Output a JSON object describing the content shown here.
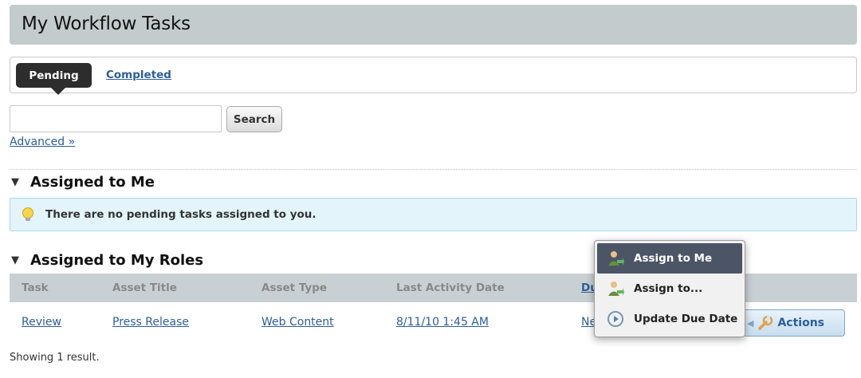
{
  "page_title": "My Workflow Tasks",
  "tabs": {
    "pending": "Pending",
    "completed": "Completed"
  },
  "search": {
    "value": "",
    "button": "Search",
    "advanced": "Advanced »"
  },
  "assigned_to_me": {
    "heading": "Assigned to Me",
    "message": "There are no pending tasks assigned to you."
  },
  "assigned_to_roles": {
    "heading": "Assigned to My Roles",
    "columns": [
      "Task",
      "Asset Title",
      "Asset Type",
      "Last Activity Date",
      "Du"
    ],
    "rows": [
      {
        "task": "Review",
        "asset_title": "Press Release",
        "asset_type": "Web Content",
        "last_activity": "8/11/10 1:45 AM",
        "due": "Ne"
      }
    ]
  },
  "actions": {
    "label": "Actions"
  },
  "menu": {
    "items": [
      {
        "label": "Assign to Me",
        "icon": "assign-user-icon"
      },
      {
        "label": "Assign to...",
        "icon": "assign-user-icon"
      },
      {
        "label": "Update Due Date",
        "icon": "clock-icon"
      }
    ]
  },
  "footer": "Showing 1 result.",
  "colors": {
    "link": "#2b5e9c",
    "title_bar": "#c3cbcd",
    "info_bg": "#e3f4fb",
    "menu_highlight": "#4c5566"
  }
}
